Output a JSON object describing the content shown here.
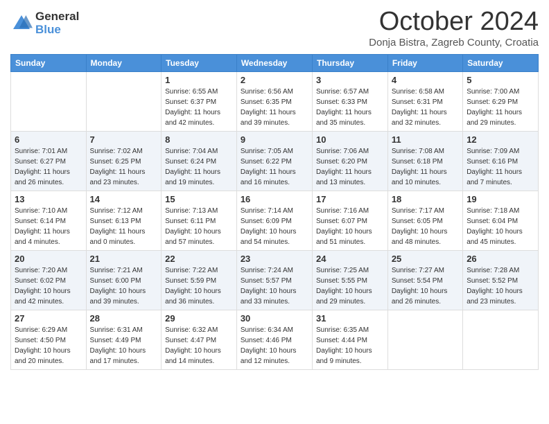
{
  "header": {
    "logo": {
      "general": "General",
      "blue": "Blue"
    },
    "title": "October 2024",
    "location": "Donja Bistra, Zagreb County, Croatia"
  },
  "weekdays": [
    "Sunday",
    "Monday",
    "Tuesday",
    "Wednesday",
    "Thursday",
    "Friday",
    "Saturday"
  ],
  "weeks": [
    [
      {
        "day": "",
        "sunrise": "",
        "sunset": "",
        "daylight": ""
      },
      {
        "day": "",
        "sunrise": "",
        "sunset": "",
        "daylight": ""
      },
      {
        "day": "1",
        "sunrise": "Sunrise: 6:55 AM",
        "sunset": "Sunset: 6:37 PM",
        "daylight": "Daylight: 11 hours and 42 minutes."
      },
      {
        "day": "2",
        "sunrise": "Sunrise: 6:56 AM",
        "sunset": "Sunset: 6:35 PM",
        "daylight": "Daylight: 11 hours and 39 minutes."
      },
      {
        "day": "3",
        "sunrise": "Sunrise: 6:57 AM",
        "sunset": "Sunset: 6:33 PM",
        "daylight": "Daylight: 11 hours and 35 minutes."
      },
      {
        "day": "4",
        "sunrise": "Sunrise: 6:58 AM",
        "sunset": "Sunset: 6:31 PM",
        "daylight": "Daylight: 11 hours and 32 minutes."
      },
      {
        "day": "5",
        "sunrise": "Sunrise: 7:00 AM",
        "sunset": "Sunset: 6:29 PM",
        "daylight": "Daylight: 11 hours and 29 minutes."
      }
    ],
    [
      {
        "day": "6",
        "sunrise": "Sunrise: 7:01 AM",
        "sunset": "Sunset: 6:27 PM",
        "daylight": "Daylight: 11 hours and 26 minutes."
      },
      {
        "day": "7",
        "sunrise": "Sunrise: 7:02 AM",
        "sunset": "Sunset: 6:25 PM",
        "daylight": "Daylight: 11 hours and 23 minutes."
      },
      {
        "day": "8",
        "sunrise": "Sunrise: 7:04 AM",
        "sunset": "Sunset: 6:24 PM",
        "daylight": "Daylight: 11 hours and 19 minutes."
      },
      {
        "day": "9",
        "sunrise": "Sunrise: 7:05 AM",
        "sunset": "Sunset: 6:22 PM",
        "daylight": "Daylight: 11 hours and 16 minutes."
      },
      {
        "day": "10",
        "sunrise": "Sunrise: 7:06 AM",
        "sunset": "Sunset: 6:20 PM",
        "daylight": "Daylight: 11 hours and 13 minutes."
      },
      {
        "day": "11",
        "sunrise": "Sunrise: 7:08 AM",
        "sunset": "Sunset: 6:18 PM",
        "daylight": "Daylight: 11 hours and 10 minutes."
      },
      {
        "day": "12",
        "sunrise": "Sunrise: 7:09 AM",
        "sunset": "Sunset: 6:16 PM",
        "daylight": "Daylight: 11 hours and 7 minutes."
      }
    ],
    [
      {
        "day": "13",
        "sunrise": "Sunrise: 7:10 AM",
        "sunset": "Sunset: 6:14 PM",
        "daylight": "Daylight: 11 hours and 4 minutes."
      },
      {
        "day": "14",
        "sunrise": "Sunrise: 7:12 AM",
        "sunset": "Sunset: 6:13 PM",
        "daylight": "Daylight: 11 hours and 0 minutes."
      },
      {
        "day": "15",
        "sunrise": "Sunrise: 7:13 AM",
        "sunset": "Sunset: 6:11 PM",
        "daylight": "Daylight: 10 hours and 57 minutes."
      },
      {
        "day": "16",
        "sunrise": "Sunrise: 7:14 AM",
        "sunset": "Sunset: 6:09 PM",
        "daylight": "Daylight: 10 hours and 54 minutes."
      },
      {
        "day": "17",
        "sunrise": "Sunrise: 7:16 AM",
        "sunset": "Sunset: 6:07 PM",
        "daylight": "Daylight: 10 hours and 51 minutes."
      },
      {
        "day": "18",
        "sunrise": "Sunrise: 7:17 AM",
        "sunset": "Sunset: 6:05 PM",
        "daylight": "Daylight: 10 hours and 48 minutes."
      },
      {
        "day": "19",
        "sunrise": "Sunrise: 7:18 AM",
        "sunset": "Sunset: 6:04 PM",
        "daylight": "Daylight: 10 hours and 45 minutes."
      }
    ],
    [
      {
        "day": "20",
        "sunrise": "Sunrise: 7:20 AM",
        "sunset": "Sunset: 6:02 PM",
        "daylight": "Daylight: 10 hours and 42 minutes."
      },
      {
        "day": "21",
        "sunrise": "Sunrise: 7:21 AM",
        "sunset": "Sunset: 6:00 PM",
        "daylight": "Daylight: 10 hours and 39 minutes."
      },
      {
        "day": "22",
        "sunrise": "Sunrise: 7:22 AM",
        "sunset": "Sunset: 5:59 PM",
        "daylight": "Daylight: 10 hours and 36 minutes."
      },
      {
        "day": "23",
        "sunrise": "Sunrise: 7:24 AM",
        "sunset": "Sunset: 5:57 PM",
        "daylight": "Daylight: 10 hours and 33 minutes."
      },
      {
        "day": "24",
        "sunrise": "Sunrise: 7:25 AM",
        "sunset": "Sunset: 5:55 PM",
        "daylight": "Daylight: 10 hours and 29 minutes."
      },
      {
        "day": "25",
        "sunrise": "Sunrise: 7:27 AM",
        "sunset": "Sunset: 5:54 PM",
        "daylight": "Daylight: 10 hours and 26 minutes."
      },
      {
        "day": "26",
        "sunrise": "Sunrise: 7:28 AM",
        "sunset": "Sunset: 5:52 PM",
        "daylight": "Daylight: 10 hours and 23 minutes."
      }
    ],
    [
      {
        "day": "27",
        "sunrise": "Sunrise: 6:29 AM",
        "sunset": "Sunset: 4:50 PM",
        "daylight": "Daylight: 10 hours and 20 minutes."
      },
      {
        "day": "28",
        "sunrise": "Sunrise: 6:31 AM",
        "sunset": "Sunset: 4:49 PM",
        "daylight": "Daylight: 10 hours and 17 minutes."
      },
      {
        "day": "29",
        "sunrise": "Sunrise: 6:32 AM",
        "sunset": "Sunset: 4:47 PM",
        "daylight": "Daylight: 10 hours and 14 minutes."
      },
      {
        "day": "30",
        "sunrise": "Sunrise: 6:34 AM",
        "sunset": "Sunset: 4:46 PM",
        "daylight": "Daylight: 10 hours and 12 minutes."
      },
      {
        "day": "31",
        "sunrise": "Sunrise: 6:35 AM",
        "sunset": "Sunset: 4:44 PM",
        "daylight": "Daylight: 10 hours and 9 minutes."
      },
      {
        "day": "",
        "sunrise": "",
        "sunset": "",
        "daylight": ""
      },
      {
        "day": "",
        "sunrise": "",
        "sunset": "",
        "daylight": ""
      }
    ]
  ]
}
